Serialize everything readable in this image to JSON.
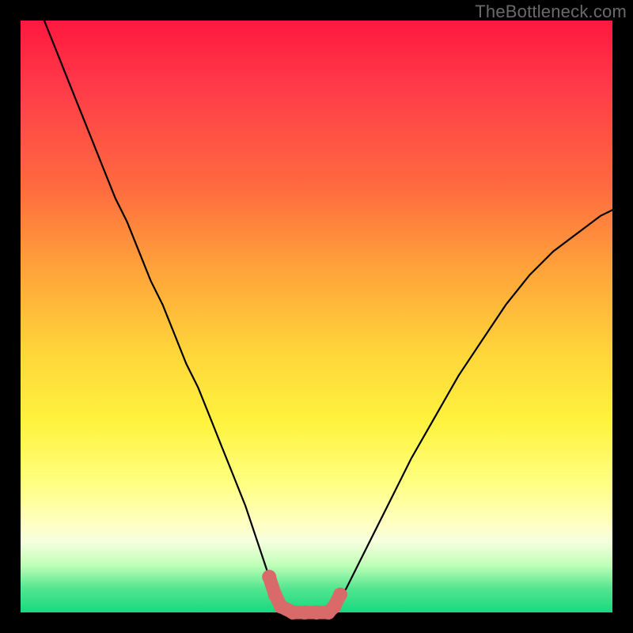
{
  "watermark": "TheBottleneck.com",
  "chart_data": {
    "type": "line",
    "title": "",
    "xlabel": "",
    "ylabel": "",
    "xlim": [
      0,
      100
    ],
    "ylim": [
      0,
      100
    ],
    "series": [
      {
        "name": "curve",
        "x": [
          4,
          6,
          8,
          10,
          12,
          14,
          16,
          18,
          20,
          22,
          24,
          26,
          28,
          30,
          32,
          34,
          36,
          38,
          40,
          42,
          43,
          44,
          46,
          48,
          50,
          52,
          53,
          55,
          58,
          62,
          66,
          70,
          74,
          78,
          82,
          86,
          90,
          94,
          98,
          100
        ],
        "values": [
          100,
          95,
          90,
          85,
          80,
          75,
          70,
          66,
          61,
          56,
          52,
          47,
          42,
          38,
          33,
          28,
          23,
          18,
          12,
          6,
          3,
          1,
          0,
          0,
          0,
          0,
          1,
          4,
          10,
          18,
          26,
          33,
          40,
          46,
          52,
          57,
          61,
          64,
          67,
          68
        ]
      },
      {
        "name": "marker-cluster",
        "x": [
          42,
          43,
          44,
          46,
          48,
          50,
          52,
          53,
          54
        ],
        "values": [
          6,
          3,
          1,
          0,
          0,
          0,
          0,
          1,
          3
        ]
      }
    ],
    "colors": {
      "curve": "#000000",
      "markers": "#d96a6a",
      "background_top": "#ff183f",
      "background_bottom": "#17d87f"
    }
  }
}
